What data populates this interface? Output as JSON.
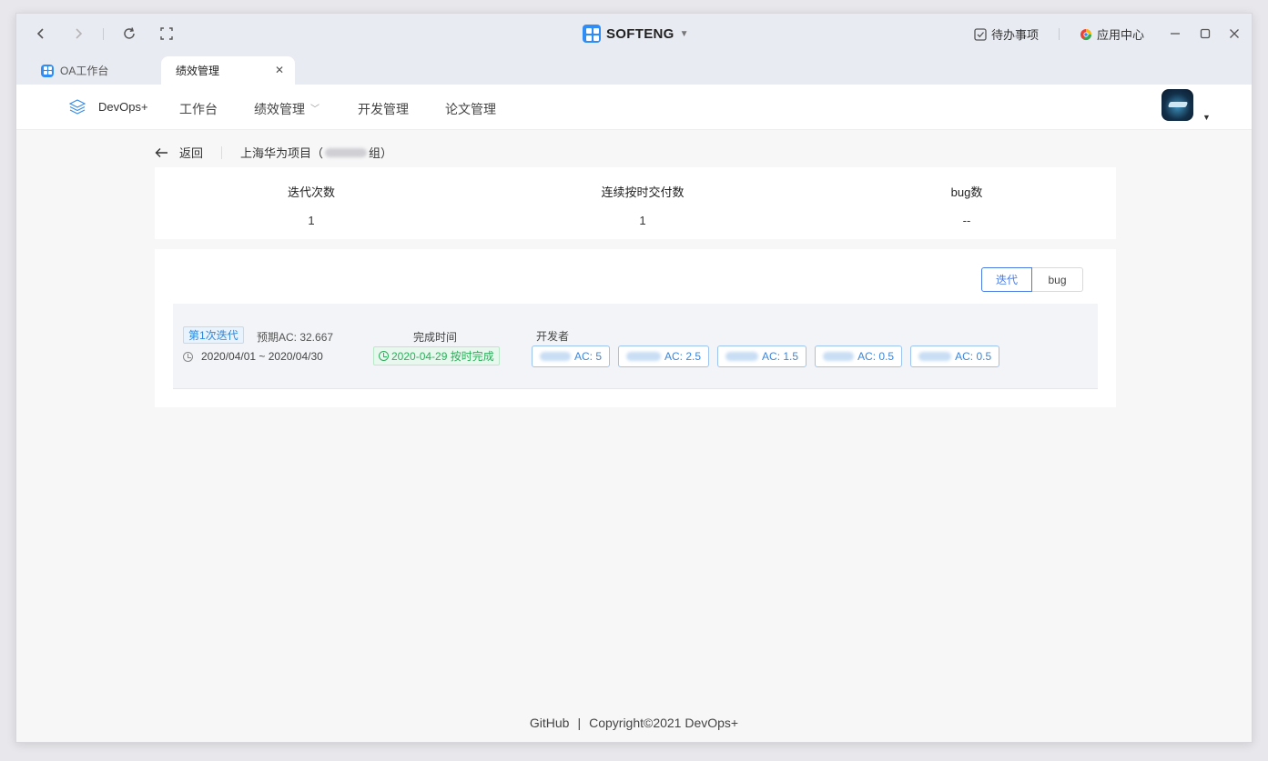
{
  "browser": {
    "app_name": "SOFTENG",
    "todo_label": "待办事项",
    "app_center_label": "应用中心",
    "tabs": [
      {
        "label": "OA工作台"
      },
      {
        "label": "绩效管理",
        "close": "✕"
      }
    ]
  },
  "nav": {
    "brand": "DevOps+",
    "items": [
      {
        "label": "工作台"
      },
      {
        "label": "绩效管理"
      },
      {
        "label": "开发管理"
      },
      {
        "label": "论文管理"
      }
    ]
  },
  "breadcrumb": {
    "back_label": "返回",
    "project_prefix": "上海华为项目（",
    "project_suffix": "组）"
  },
  "summary": {
    "stats": [
      {
        "label": "迭代次数",
        "value": "1"
      },
      {
        "label": "连续按时交付数",
        "value": "1"
      },
      {
        "label": "bug数",
        "value": "--"
      }
    ]
  },
  "iteration_view": {
    "toggle": [
      "迭代",
      "bug"
    ],
    "iteration": {
      "name": "第1次迭代",
      "estimated_ac": "预期AC: 32.667",
      "date_range": "2020/04/01 ~ 2020/04/30",
      "completed_label": "完成时间",
      "completed_status": "2020-04-29 按时完成",
      "developers_label": "开发者",
      "developers": [
        {
          "ac": "AC: 5"
        },
        {
          "ac": "AC: 2.5"
        },
        {
          "ac": "AC: 1.5"
        },
        {
          "ac": "AC: 0.5"
        },
        {
          "ac": "AC: 0.5"
        }
      ]
    }
  },
  "footer": {
    "github": "GitHub",
    "separator": "|",
    "copyright": "Copyright©2021 DevOps+"
  },
  "colors": {
    "accent": "#4a7be5",
    "tag_blue": "#3a87dd",
    "success_green": "#2aaf5a"
  }
}
